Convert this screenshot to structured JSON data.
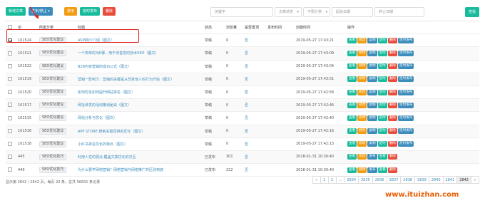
{
  "toolbar": {
    "new": "新增文章",
    "batch_publish": "发布/停止",
    "sort": "排序",
    "timed": "定时发布",
    "delete": "删除",
    "search": "查找"
  },
  "filters": {
    "keyword_placeholder": "关键字",
    "status": "文章状态",
    "category": "不限分类",
    "start_date": "起始日期",
    "end_date": "终止日期"
  },
  "columns": [
    "ID",
    "所属分类",
    "标题",
    "状态",
    "浏览量",
    "是否置顶",
    "发布时间",
    "创建时间",
    "操作"
  ],
  "op_labels": {
    "view": "查看",
    "edit": "修改",
    "copy": "复制",
    "time": "定时",
    "del": "删除",
    "timed_pub": "定时发布",
    "publish": "发布"
  },
  "rows": [
    {
      "checked": true,
      "id": "101524",
      "cat": "SEO优化建议",
      "title": "ASM简介介绍（图文）",
      "status": "草稿",
      "views": "0",
      "top": "否",
      "created": "2019-05-27 17:43:21"
    },
    {
      "checked": false,
      "id": "101521",
      "cat": "SEO优化建议",
      "title": "一个简单的3步骤，用于改善您的技术SEO（图文）",
      "status": "草稿",
      "views": "0",
      "top": "否",
      "created": "2019-05-27 17:43:09"
    },
    {
      "checked": false,
      "id": "101522",
      "cat": "SEO优化建议",
      "title": "B2B内容营销的成功公式（图文）",
      "status": "草稿",
      "views": "0",
      "top": "否",
      "created": "2019-05-27 17:43:04"
    },
    {
      "checked": false,
      "id": "101519",
      "cat": "SEO优化建议",
      "title": "营销一影响力：营销的关键是从改变他人的行为开始（图文）",
      "status": "草稿",
      "views": "0",
      "top": "否",
      "created": "2019-05-27 17:43:01"
    },
    {
      "checked": false,
      "id": "101520",
      "cat": "SEO优化建议",
      "title": "如何优化如何提升网站排名（图文）",
      "status": "草稿",
      "views": "0",
      "top": "否",
      "created": "2019-05-27 17:42:58"
    },
    {
      "checked": false,
      "id": "101517",
      "cat": "SEO优化建议",
      "title": "网址转发的活动策划秘诀（图文）",
      "status": "草稿",
      "views": "0",
      "top": "否",
      "created": "2019-05-27 17:42:46"
    },
    {
      "checked": false,
      "id": "101515",
      "cat": "SEO优化建议",
      "title": "网站分析与优化（图文）",
      "status": "草稿",
      "views": "0",
      "top": "否",
      "created": "2019-05-27 17:42:40"
    },
    {
      "checked": false,
      "id": "101516",
      "cat": "SEO优化建议",
      "title": "APP STORE 搜索关键词排名优化（图文）",
      "status": "草稿",
      "views": "0",
      "top": "否",
      "created": "2019-05-27 17:42:16"
    },
    {
      "checked": false,
      "id": "101518",
      "cat": "SEO优化建议",
      "title": "小红书排名优化的特点（图文）",
      "status": "草稿",
      "views": "0",
      "top": "否",
      "created": "2019-05-27 17:42:13"
    },
    {
      "checked": false,
      "id": "445",
      "cat": "SEO优化技巧",
      "title": "利用人性的弱点,覆盖文案优化的交互",
      "status": "已发布",
      "views": "301",
      "top": "否",
      "created": "2018-01-31 10:30:40"
    },
    {
      "checked": false,
      "id": "449",
      "cat": "SEO优化技巧",
      "title": "为什么要学网络营销？网络营销与网络推广的区别到底",
      "status": "已发布",
      "views": "222",
      "top": "否",
      "created": "2018-01-31 10:30:40"
    }
  ],
  "footer": "显示第 2842 / 2842 页，每页 20 条，总共 56831 条记录",
  "pager": [
    "«",
    "1",
    "2",
    "...",
    "2834",
    "2835",
    "2836",
    "2837",
    "2838",
    "2839",
    "2840",
    "2841",
    "2842",
    "»"
  ],
  "pager_active": "2842",
  "watermark": "www.ituizhan.com",
  "colors": {
    "primary": "#3c8dbc",
    "success": "#18bc9c",
    "warning": "#f39c12",
    "danger": "#e74c3c",
    "highlight": "#e02020"
  }
}
